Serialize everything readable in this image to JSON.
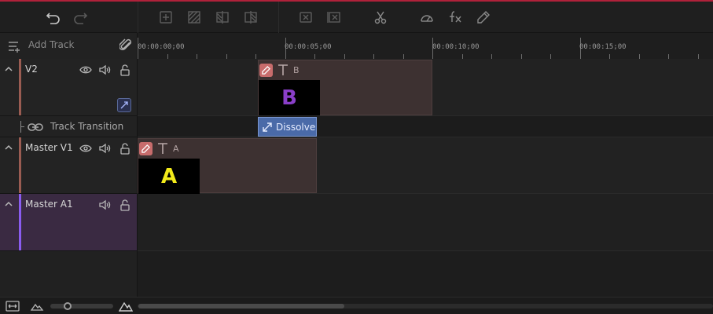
{
  "toolbar": {
    "icons": [
      "undo-icon",
      "redo-icon",
      "add-marker-icon",
      "crop-icon",
      "split-left-icon",
      "split-right-icon",
      "delete-icon",
      "ripple-delete-icon",
      "cut-icon",
      "speed-icon",
      "effects-icon",
      "edit-pen-icon"
    ]
  },
  "header": {
    "add_track_label": "Add Track"
  },
  "ruler": {
    "timecodes": [
      "00:00:00;00",
      "00:00:05;00",
      "00:00:10;00",
      "00:00:15;00"
    ]
  },
  "tracks": {
    "v2": {
      "name": "V2"
    },
    "transition": {
      "label": "Track Transition"
    },
    "v1": {
      "name": "Master V1"
    },
    "a1": {
      "name": "Master A1"
    }
  },
  "clips": {
    "b": {
      "name": "B",
      "thumb_text": "B"
    },
    "a": {
      "name": "A",
      "thumb_text": "A"
    }
  },
  "transition_clip": {
    "label": "Dissolve"
  },
  "colors": {
    "accent_red": "#b0213a",
    "video_track_bar": "#9a5c52",
    "audio_track_bar": "#8a5cf0",
    "transition_block": "#4a6aa8",
    "thumb_b_text": "#8a3fc9",
    "thumb_a_text": "#f2ea1a"
  }
}
